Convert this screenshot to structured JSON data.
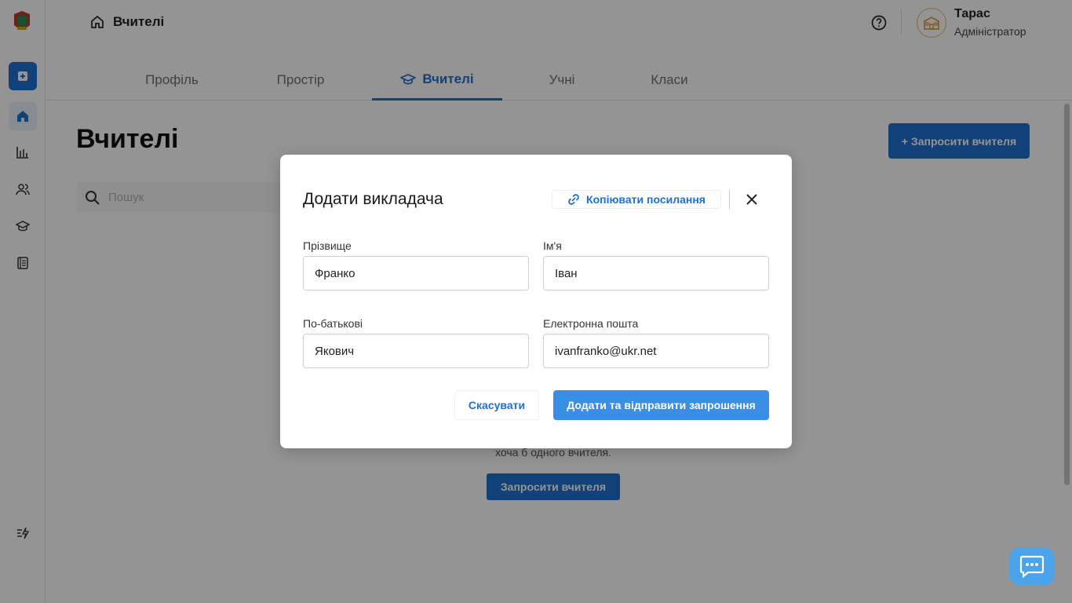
{
  "header": {
    "breadcrumb": "Вчителі",
    "user_name": "Тарас",
    "user_role": "Адміністратор"
  },
  "tabs": [
    {
      "label": "Профіль",
      "active": false
    },
    {
      "label": "Простір",
      "active": false
    },
    {
      "label": "Вчителі",
      "active": true
    },
    {
      "label": "Учні",
      "active": false
    },
    {
      "label": "Класи",
      "active": false
    }
  ],
  "main": {
    "title": "Вчителі",
    "invite_button": "+ Запросити вчителя",
    "search_placeholder": "Пошук",
    "empty_text": "хоча б одного вчителя.",
    "empty_button": "Запросити вчителя"
  },
  "modal": {
    "title": "Додати викладача",
    "copy_link": "Копіювати посилання",
    "fields": [
      {
        "label": "Прізвище",
        "value": "Франко"
      },
      {
        "label": "Ім'я",
        "value": "Іван"
      },
      {
        "label": "По-батькові",
        "value": "Якович"
      },
      {
        "label": "Електронна пошта",
        "value": "ivanfranko@ukr.net"
      }
    ],
    "cancel": "Скасувати",
    "submit": "Додати та відправити запрошення"
  },
  "colors": {
    "accent": "#1f6fd1",
    "submit": "#3a8ee6",
    "chat": "#4ba3e9"
  },
  "icons": [
    "logo-icon",
    "add-icon",
    "home-icon",
    "stats-icon",
    "users-icon",
    "graduation-cap-icon",
    "journal-icon",
    "settings-bolt-icon",
    "help-icon",
    "school-icon",
    "search-icon",
    "link-icon",
    "close-icon",
    "chat-icon"
  ]
}
